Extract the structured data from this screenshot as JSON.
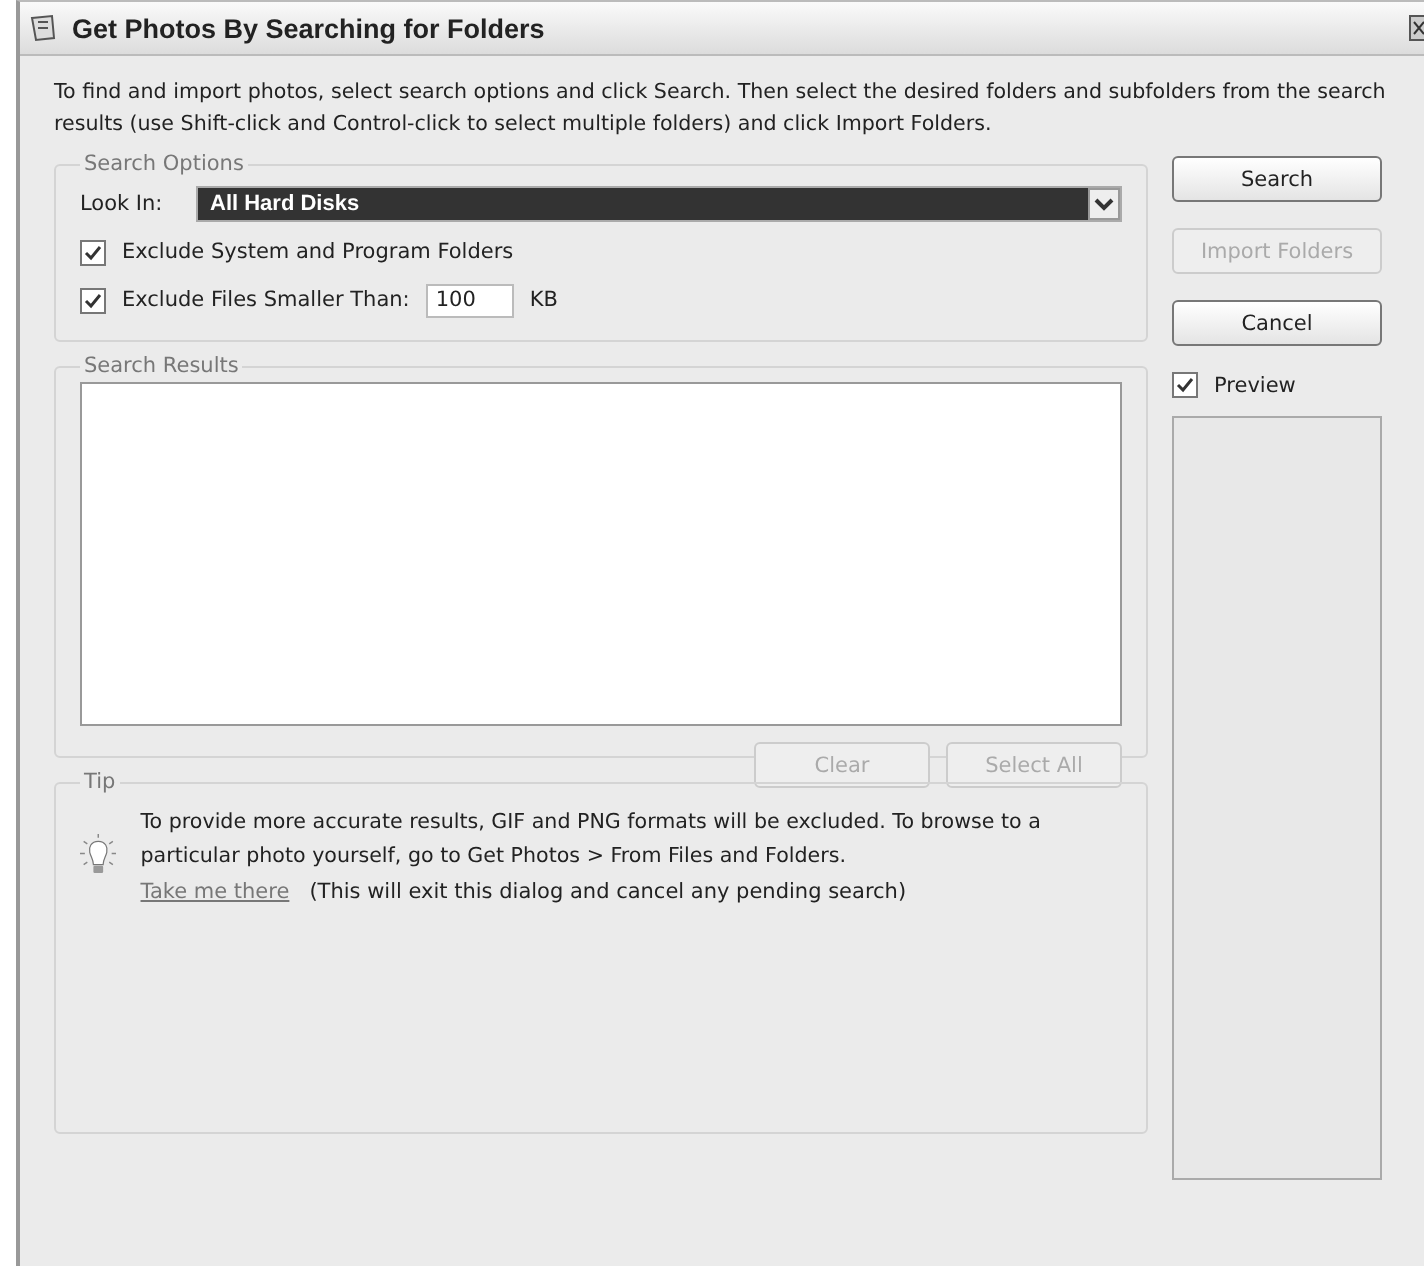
{
  "window": {
    "title": "Get Photos By Searching for Folders"
  },
  "intro": "To find and import photos, select search options and click Search. Then select the desired folders and subfolders from the search results (use Shift-click and Control-click to select multiple folders) and click Import Folders.",
  "search_options": {
    "legend": "Search Options",
    "look_in_label": "Look In:",
    "look_in_value": "All Hard Disks",
    "checkboxes": [
      {
        "label": "Exclude System and Program Folders",
        "checked": true
      },
      {
        "label": "Exclude Files Smaller Than:",
        "checked": true,
        "value": "100",
        "unit": "KB"
      }
    ]
  },
  "search_results": {
    "legend": "Search Results",
    "buttons": [
      {
        "label": "Clear",
        "disabled": true
      },
      {
        "label": "Select All",
        "disabled": true
      }
    ]
  },
  "tip": {
    "legend": "Tip",
    "text": "To provide more accurate results, GIF and PNG formats will be excluded. To browse to a particular photo yourself, go to Get Photos > From Files and Folders.",
    "link": "Take me there",
    "note": "(This will exit this dialog and cancel any pending search)"
  },
  "side_buttons": [
    {
      "label": "Search",
      "disabled": false
    },
    {
      "label": "Import Folders",
      "disabled": true
    },
    {
      "label": "Cancel",
      "disabled": false
    }
  ],
  "preview": {
    "label": "Preview",
    "checked": true
  }
}
